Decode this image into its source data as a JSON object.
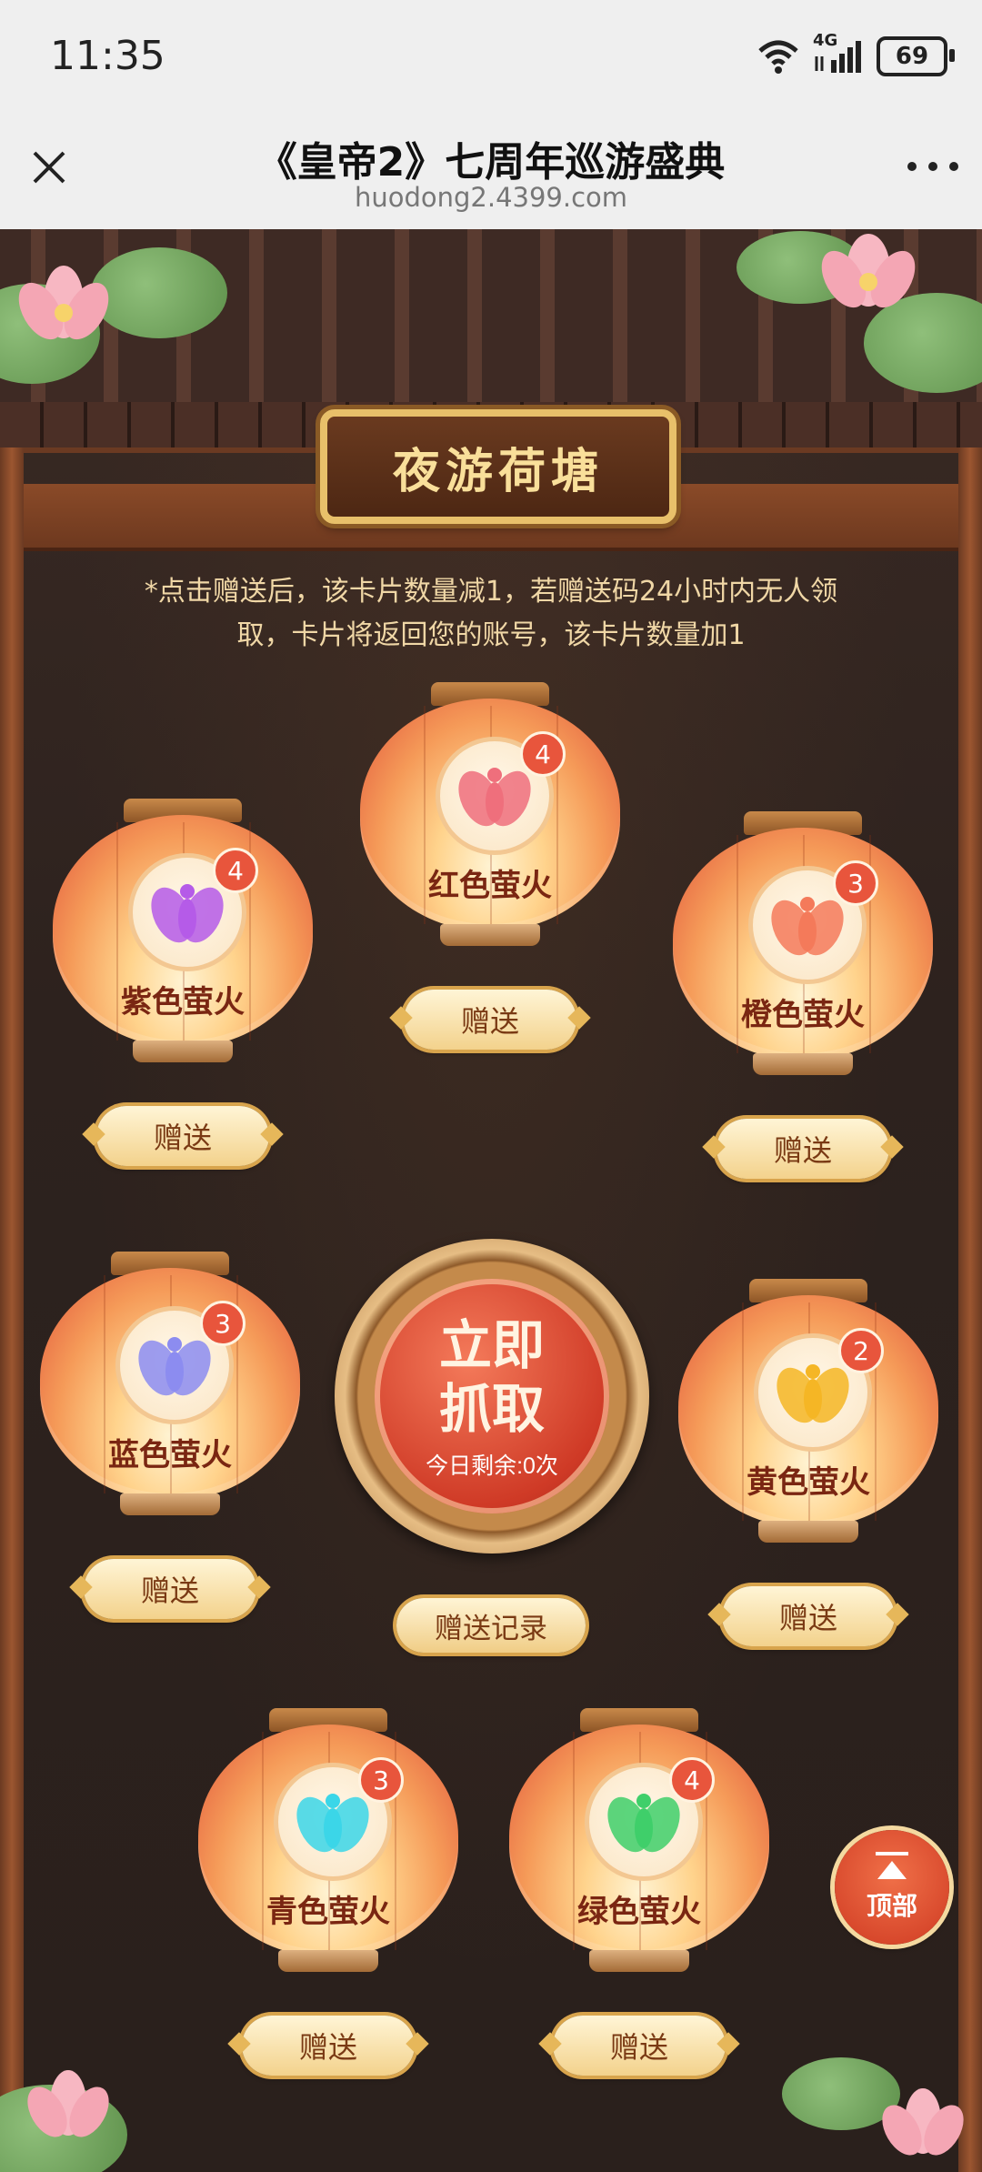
{
  "status_bar": {
    "time": "11:35",
    "network": "4G",
    "battery": "69"
  },
  "nav": {
    "title": "《皇帝2》七周年巡游盛典",
    "url": "huodong2.4399.com"
  },
  "plaque_title": "夜游荷塘",
  "notice": "*点击赠送后，该卡片数量减1，若赠送码24小时内无人领取，卡片将返回您的账号，该卡片数量加1",
  "send_label": "赠送",
  "cards": [
    {
      "name": "紫色萤火",
      "count": "4",
      "color": "#b55be8"
    },
    {
      "name": "红色萤火",
      "count": "4",
      "color": "#ef6f7c"
    },
    {
      "name": "橙色萤火",
      "count": "3",
      "color": "#f47a5a"
    },
    {
      "name": "蓝色萤火",
      "count": "3",
      "color": "#8c8cf0"
    },
    {
      "name": "黄色萤火",
      "count": "2",
      "color": "#f5b625"
    },
    {
      "name": "青色萤火",
      "count": "3",
      "color": "#3bd6e8"
    },
    {
      "name": "绿色萤火",
      "count": "4",
      "color": "#3fcf6a"
    }
  ],
  "grab": {
    "line1": "立即",
    "line2": "抓取",
    "remaining": "今日剩余:0次"
  },
  "record_label": "赠送记录",
  "top_label": "顶部"
}
